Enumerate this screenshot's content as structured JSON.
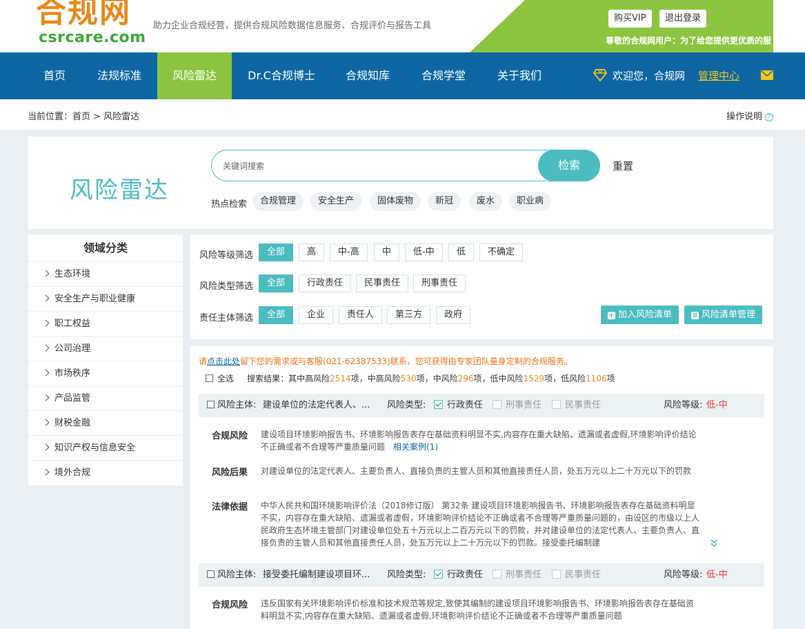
{
  "header": {
    "logo_cn": "合规网",
    "logo_en": "csrcare.com",
    "slogan": "助力企业合规经营，提供合规风险数据信息服务、合规评价与报告工具",
    "vip_label": "购买VIP",
    "logout_label": "退出登录",
    "greeting": "尊敬的合规网用户：为了给您提供更优质的服"
  },
  "nav": {
    "items": [
      "首页",
      "法规标准",
      "风险雷达",
      "Dr.C合规博士",
      "合规知库",
      "合规学堂",
      "关于我们"
    ],
    "active": "风险雷达",
    "welcome": "欢迎您，合规网",
    "manage": "管理中心"
  },
  "breadcrumb": {
    "text": "当前位置：首页 > 风险雷达",
    "help": "操作说明"
  },
  "search": {
    "title": "风险雷达",
    "placeholder": "关键词搜索",
    "button": "检索",
    "reset": "重置",
    "hot_label": "热点检索",
    "hot_tags": [
      "合规管理",
      "安全生产",
      "固体废物",
      "新冠",
      "废水",
      "职业病"
    ]
  },
  "sidebar": {
    "title": "领域分类",
    "items": [
      "生态环境",
      "安全生产与职业健康",
      "职工权益",
      "公司治理",
      "市场秩序",
      "产品监管",
      "财税金融",
      "知识产权与信息安全",
      "境外合规"
    ]
  },
  "filters": {
    "level_label": "风险等级筛选",
    "levels": [
      "全部",
      "高",
      "中-高",
      "中",
      "低-中",
      "低",
      "不确定"
    ],
    "type_label": "风险类型筛选",
    "types": [
      "全部",
      "行政责任",
      "民事责任",
      "刑事责任"
    ],
    "subject_label": "责任主体筛选",
    "subjects": [
      "全部",
      "企业",
      "责任人",
      "第三方",
      "政府"
    ],
    "add_list": "加入风险清单",
    "manage_list": "风险清单管理"
  },
  "results": {
    "notice_pre": "请",
    "notice_link": "点击此处",
    "notice_post": "留下您的需求或与客服(021-62387533)联系，您可获得由专家团队量身定制的合规服务。",
    "select_all": "全选",
    "summary_pre": "搜索结果：其中高风险",
    "count_high": "2514",
    "s1": "项，中高风险",
    "count_midhigh": "530",
    "s2": "项，中风险",
    "count_mid": "296",
    "s3": "项，低中风险",
    "count_lowmid": "1529",
    "s4": "项，低风险",
    "count_low": "1106",
    "s5": "项",
    "head_labels": {
      "subject": "风险主体:",
      "type": "风险类型:",
      "admin": "行政责任",
      "criminal": "刑事责任",
      "civil": "民事责任",
      "level": "风险等级:"
    },
    "items": [
      {
        "subject": "建设单位的法定代表人、...",
        "level": "低-中",
        "risk_label": "合规风险",
        "risk": "建设项目环境影响报告书、环境影响报告表存在基础资料明显不实,内容存在重大缺陷、遗漏或者虚假,环境影响评价结论不正确或者不合理等严重质量问题",
        "case_link": "相关案例(1)",
        "consequence_label": "风险后果",
        "consequence": "对建设单位的法定代表人、主要负责人、直接负责的主管人员和其他直接责任人员，处五万元以上二十万元以下的罚款",
        "law_label": "法律依据",
        "law": "中华人民共和国环境影响评价法（2018修订版） 第32条 建设项目环境影响报告书、环境影响报告表存在基础资料明显不实，内容存在重大缺陷、遗漏或者虚假，环境影响评价结论不正确或者不合理等严重质量问题的，由设区的市级以上人民政府生态环境主管部门对建设单位处五十万元以上二百万元以下的罚款，并对建设单位的法定代表人、主要负责人、直接负责的主管人员和其他直接责任人员，处五万元以上二十万元以下的罚款。接受委托编制建"
      },
      {
        "subject": "接受委托编制建设项目环...",
        "level": "低-中",
        "risk_label": "合规风险",
        "risk": "违反国家有关环境影响评价标准和技术规范等规定,致使其编制的建设项目环境影响报告书、环境影响报告表存在基础资料明显不实,内容存在重大缺陷、遗漏或者虚假,环境影响评价结论不正确或者不合理等严重质量问题"
      }
    ]
  },
  "colors": {
    "brand_teal": "#4bbcc0",
    "nav_blue": "#0e67a3",
    "accent_green": "#8bc53f",
    "logo_orange": "#e8891a",
    "risk_red": "#e33333"
  }
}
